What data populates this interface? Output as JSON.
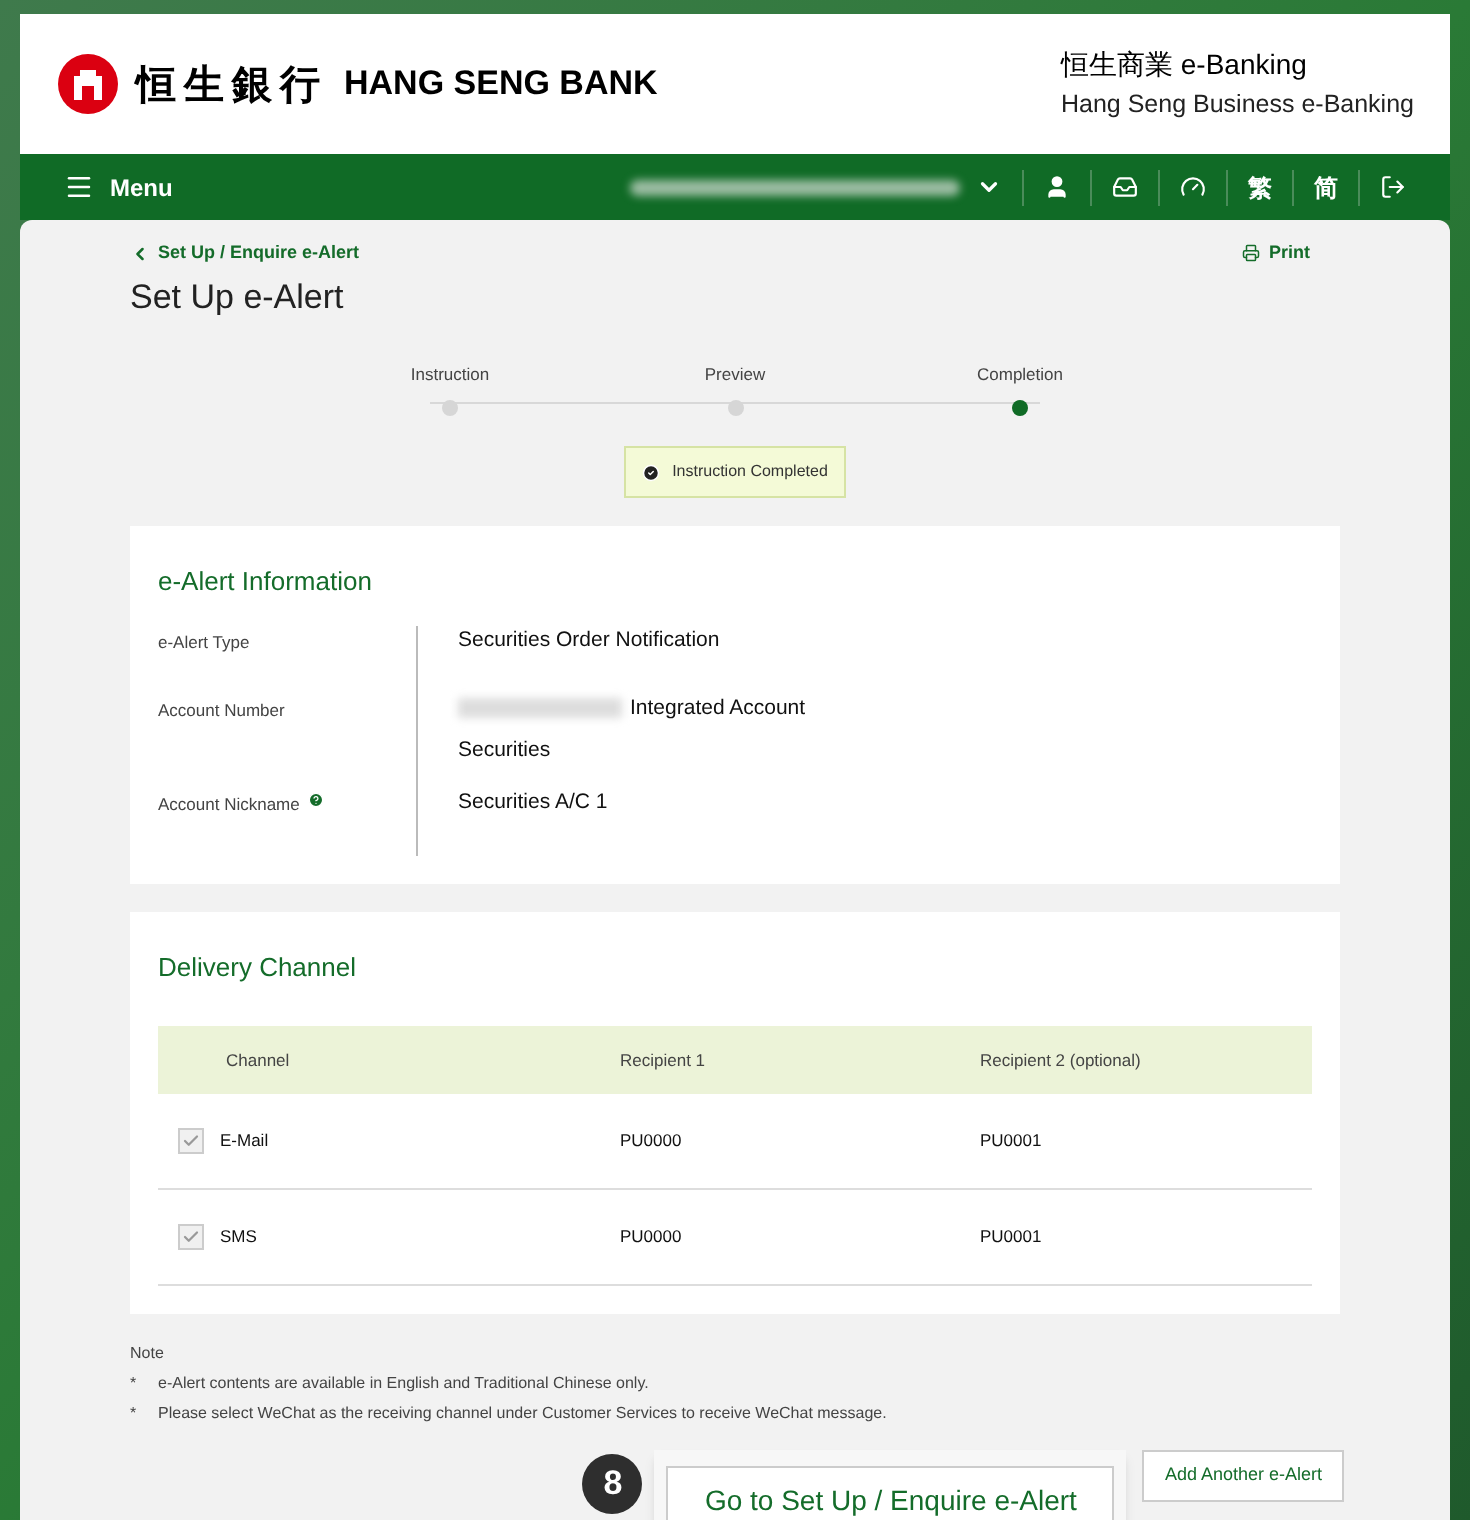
{
  "header": {
    "bank_chinese": "恒生銀行",
    "bank_english": "HANG SENG BANK",
    "product_chinese": "恒生商業 e-Banking",
    "product_english": "Hang Seng Business e-Banking"
  },
  "nav": {
    "menu": "Menu",
    "languages": [
      "繁",
      "简"
    ]
  },
  "breadcrumb": "Set Up / Enquire e-Alert",
  "print": "Print",
  "title": "Set Up e-Alert",
  "steps": [
    {
      "label": "Instruction",
      "selected": false
    },
    {
      "label": "Preview",
      "selected": false
    },
    {
      "label": "Completion",
      "selected": true
    }
  ],
  "status_message": "Instruction Completed",
  "info": {
    "heading": "e-Alert Information",
    "rows": [
      {
        "label": "e-Alert Type",
        "value": "Securities Order Notification"
      },
      {
        "label": "Account Number",
        "value": "Integrated Account",
        "value_line2": "Securities",
        "redacted": true
      },
      {
        "label": "Account Nickname",
        "value": "Securities A/C 1",
        "help": true
      }
    ]
  },
  "delivery": {
    "heading": "Delivery Channel",
    "columns": [
      "Channel",
      "Recipient 1",
      "Recipient 2 (optional)"
    ],
    "rows": [
      {
        "channel": "E-Mail",
        "checked": true,
        "recipient_1": "PU0000",
        "recipient_2": "PU0001"
      },
      {
        "channel": "SMS",
        "checked": true,
        "recipient_1": "PU0000",
        "recipient_2": "PU0001"
      }
    ]
  },
  "note": {
    "title": "Note",
    "bullet": "*",
    "items": [
      "e-Alert contents are available in English and Traditional Chinese only.",
      "Please select WeChat as the receiving channel under Customer Services to receive WeChat message."
    ]
  },
  "buttons": [
    "Go to Set Up / Enquire e-Alert",
    "Add Another e-Alert"
  ],
  "step_badge": "8"
}
